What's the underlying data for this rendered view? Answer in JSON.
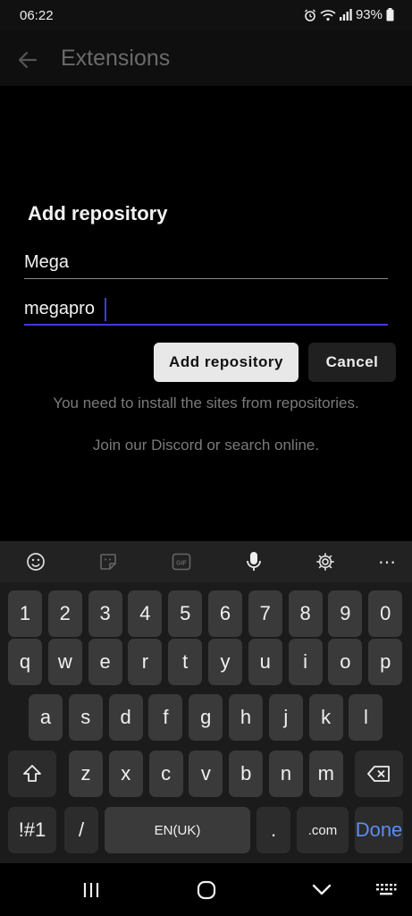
{
  "status_bar": {
    "time": "06:22",
    "battery": "93%",
    "icons": [
      "alarm-icon",
      "wifi-icon",
      "signal-icon",
      "battery-icon"
    ]
  },
  "app_bar": {
    "title": "Extensions",
    "back_icon": "back-arrow-icon"
  },
  "dialog": {
    "title": "Add repository",
    "name_value": "Mega",
    "url_value": "megapro",
    "add_label": "Add repository",
    "cancel_label": "Cancel"
  },
  "info": {
    "line1": "You need to install the sites from repositories.",
    "line2": "Join our Discord or search online."
  },
  "keyboard": {
    "toolbar": [
      "emoji-icon",
      "sticker-icon",
      "gif-icon",
      "microphone-icon",
      "settings-icon",
      "more-icon"
    ],
    "gif_label": "GIF",
    "more_label": "⋯",
    "row_numbers": [
      "1",
      "2",
      "3",
      "4",
      "5",
      "6",
      "7",
      "8",
      "9",
      "0"
    ],
    "row_top": [
      "q",
      "w",
      "e",
      "r",
      "t",
      "y",
      "u",
      "i",
      "o",
      "p"
    ],
    "row_mid": [
      "a",
      "s",
      "d",
      "f",
      "g",
      "h",
      "j",
      "k",
      "l"
    ],
    "row_bottom": [
      "z",
      "x",
      "c",
      "v",
      "b",
      "n",
      "m"
    ],
    "symbols_label": "!#1",
    "slash_label": "/",
    "space_label": "EN(UK)",
    "period_label": ".",
    "dotcom_label": ".com",
    "done_label": "Done",
    "done_color": "#5b8def"
  },
  "nav_bar": {
    "recents_icon": "recents-icon",
    "home_icon": "home-icon",
    "back_icon": "nav-back-icon",
    "keyboard_icon": "keyboard-icon"
  }
}
